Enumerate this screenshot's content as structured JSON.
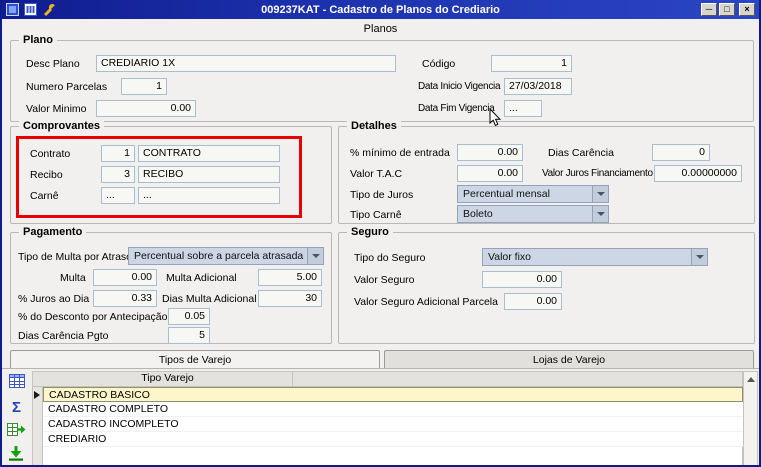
{
  "titlebar": {
    "title": "009237KAT - Cadastro de Planos do Crediario",
    "minimize": "─",
    "maximize": "□",
    "close": "×"
  },
  "page": {
    "tab_label": "Planos"
  },
  "plano": {
    "legend": "Plano",
    "desc_plano": {
      "label": "Desc Plano",
      "value": "CREDIARIO 1X"
    },
    "codigo": {
      "label": "Código",
      "value": "1"
    },
    "numero_parcelas": {
      "label": "Numero Parcelas",
      "value": "1"
    },
    "data_inicio": {
      "label": "Data Inicio Vigencia",
      "value": "27/03/2018"
    },
    "valor_minimo": {
      "label": "Valor Minimo",
      "value": "0.00"
    },
    "data_fim": {
      "label": "Data Fim Vigencia",
      "value": "..."
    }
  },
  "comprovantes": {
    "legend": "Comprovantes",
    "contrato": {
      "label": "Contrato",
      "code": "1",
      "desc": "CONTRATO"
    },
    "recibo": {
      "label": "Recibo",
      "code": "3",
      "desc": "RECIBO"
    },
    "carne": {
      "label": "Carnê",
      "code": "...",
      "desc": "..."
    }
  },
  "detalhes": {
    "legend": "Detalhes",
    "minimo_entrada": {
      "label": "% mínimo de entrada",
      "value": "0.00"
    },
    "dias_carencia": {
      "label": "Dias Carência",
      "value": "0"
    },
    "valor_tac": {
      "label": "Valor T.A.C",
      "value": "0.00"
    },
    "valor_juros_financiamento": {
      "label": "Valor Juros Financiamento",
      "value": "0.00000000"
    },
    "tipo_juros": {
      "label": "Tipo de Juros",
      "value": "Percentual mensal"
    },
    "tipo_carne": {
      "label": "Tipo Carnê",
      "value": "Boleto"
    }
  },
  "pagamento": {
    "legend": "Pagamento",
    "tipo_multa": {
      "label": "Tipo de Multa por Atraso",
      "value": "Percentual sobre a parcela atrasada"
    },
    "multa": {
      "label": "Multa",
      "value": "0.00"
    },
    "multa_adicional": {
      "label": "Multa Adicional",
      "value": "5.00"
    },
    "juros_dia": {
      "label": "% Juros ao Dia",
      "value": "0.33"
    },
    "dias_multa_adicional": {
      "label": "Dias Multa Adicional",
      "value": "30"
    },
    "desconto_antecipacao": {
      "label": "% do Desconto por Antecipação",
      "value": "0.05"
    },
    "dias_carencia_pgto": {
      "label": "Dias Carência Pgto",
      "value": "5"
    }
  },
  "seguro": {
    "legend": "Seguro",
    "tipo_seguro": {
      "label": "Tipo do Seguro",
      "value": "Valor fixo"
    },
    "valor_seguro": {
      "label": "Valor Seguro",
      "value": "0.00"
    },
    "valor_seguro_adicional": {
      "label": "Valor Seguro Adicional Parcela",
      "value": "0.00"
    }
  },
  "tabs": {
    "tipos_varejo": "Tipos de Varejo",
    "lojas_varejo": "Lojas de Varejo"
  },
  "grid": {
    "header": "Tipo Varejo",
    "rows": [
      "CADASTRO BASICO",
      "CADASTRO COMPLETO",
      "CADASTRO INCOMPLETO",
      "CREDIARIO"
    ],
    "selected_index": 0
  },
  "icons": {
    "sigma": "Σ"
  },
  "colors": {
    "titlebar_blue": "#1d33ae",
    "highlight_red": "#e60000",
    "selected_row_bg": "#fdf6ca",
    "combo_bg": "#ccd6e4"
  }
}
